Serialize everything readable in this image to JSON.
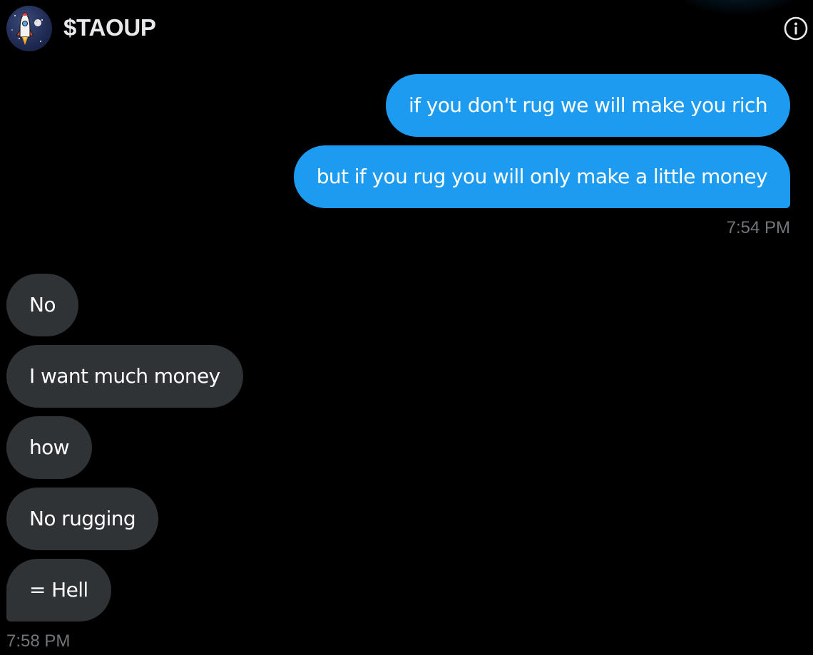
{
  "header": {
    "title": "$TAOUP",
    "avatar_icon": "rocket-icon",
    "info_icon": "info-icon"
  },
  "colors": {
    "background": "#000000",
    "sent_bubble": "#1d9bf0",
    "received_bubble": "#2f3336",
    "timestamp": "#71767b",
    "title": "#e7e9ea"
  },
  "sent_group": {
    "messages": [
      "if you don't rug we will make you rich",
      "but if you rug you will only make a little money"
    ],
    "timestamp": "7:54 PM"
  },
  "received_group": {
    "messages": [
      "No",
      "I want much money",
      "how",
      "No rugging",
      "= Hell"
    ],
    "timestamp": "7:58 PM"
  }
}
